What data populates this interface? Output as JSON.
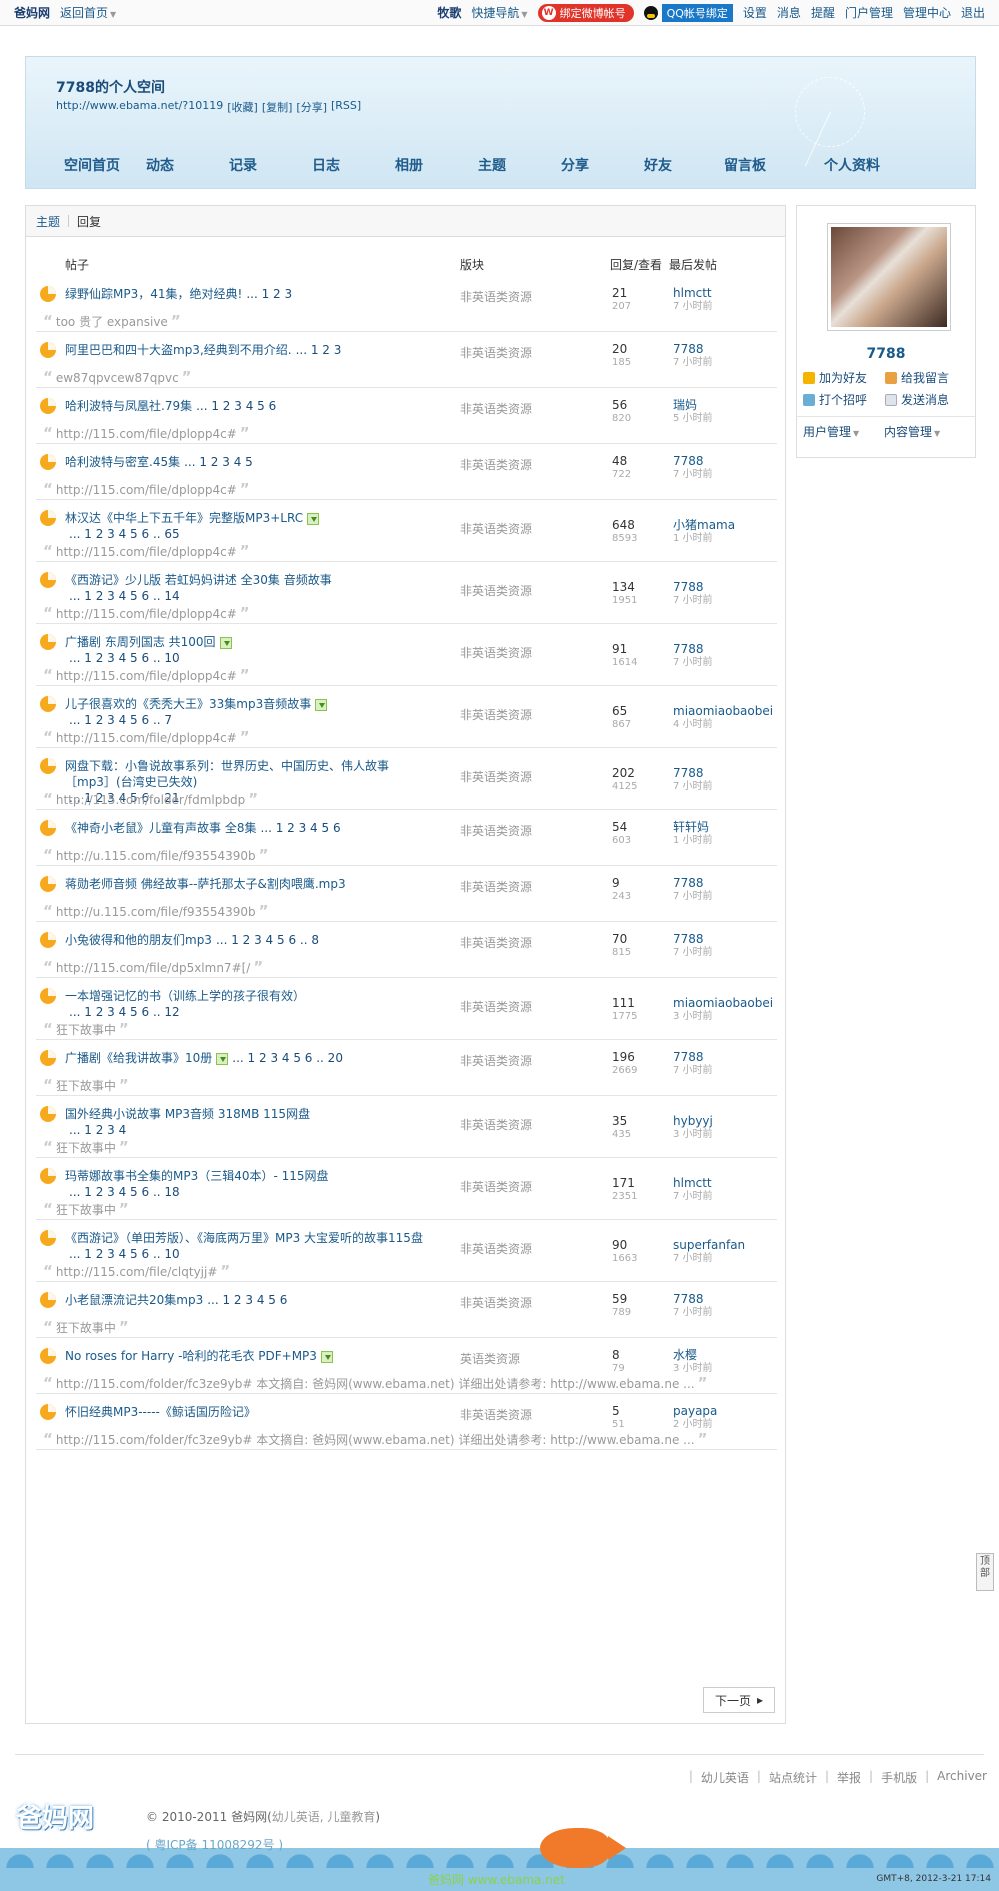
{
  "topbar": {
    "brand": "爸妈网",
    "back_home": "返回首页",
    "left_links": [],
    "right_links": [
      "牧歌",
      "快捷导航"
    ],
    "weibo": "绑定微博帐号",
    "qq": "QQ帐号绑定",
    "menu": [
      "设置",
      "消息",
      "提醒",
      "门户管理",
      "管理中心",
      "退出"
    ]
  },
  "header": {
    "title": "7788的个人空间",
    "url": "http://www.ebama.net/?10119",
    "url_actions": [
      "[收藏]",
      "[复制]",
      "[分享]",
      "[RSS]"
    ],
    "nav": [
      "空间首页",
      "动态",
      "记录",
      "日志",
      "相册",
      "主题",
      "分享",
      "好友",
      "留言板",
      "个人资料"
    ]
  },
  "tabs": {
    "theme": "主题",
    "reply": "回复"
  },
  "thead": {
    "subject": "帖子",
    "forum": "版块",
    "stats": "回复/查看",
    "last": "最后发帖"
  },
  "rows": [
    {
      "subject": "绿野仙踪MP3，41集，绝对经典!",
      "pages": "... 1 2 3",
      "dl": false,
      "forum": "非英语类资源",
      "replies": "21",
      "views": "207",
      "user": "hlmctt",
      "time": "7 小时前",
      "quote": "too 贵了 expansive"
    },
    {
      "subject": "阿里巴巴和四十大盗mp3,经典到不用介绍.",
      "pages": "... 1 2 3",
      "dl": false,
      "forum": "非英语类资源",
      "replies": "20",
      "views": "185",
      "user": "7788",
      "time": "7 小时前",
      "quote": "ew87qpvcew87qpvc"
    },
    {
      "subject": "哈利波特与凤凰社.79集",
      "pages": "... 1 2 3 4 5 6",
      "dl": false,
      "forum": "非英语类资源",
      "replies": "56",
      "views": "820",
      "user": "瑞妈",
      "time": "5 小时前",
      "quote": "http://115.com/file/dplopp4c#"
    },
    {
      "subject": "哈利波特与密室.45集",
      "pages": "... 1 2 3 4 5",
      "dl": false,
      "forum": "非英语类资源",
      "replies": "48",
      "views": "722",
      "user": "7788",
      "time": "7 小时前",
      "quote": "http://115.com/file/dplopp4c#"
    },
    {
      "subject": "林汉达《中华上下五千年》完整版MP3+LRC",
      "pages": "... 1 2 3 4 5 6 .. 65",
      "dl": true,
      "forum": "非英语类资源",
      "replies": "648",
      "views": "8593",
      "user": "小猪mama",
      "time": "1 小时前",
      "quote": "http://115.com/file/dplopp4c#"
    },
    {
      "subject": "《西游记》少儿版 若虹妈妈讲述 全30集 音频故事",
      "pages": "... 1 2 3 4 5 6 .. 14",
      "dl": false,
      "forum": "非英语类资源",
      "replies": "134",
      "views": "1951",
      "user": "7788",
      "time": "7 小时前",
      "quote": "http://115.com/file/dplopp4c#"
    },
    {
      "subject": "广播剧 东周列国志 共100回",
      "pages": "... 1 2 3 4 5 6 .. 10",
      "dl": true,
      "forum": "非英语类资源",
      "replies": "91",
      "views": "1614",
      "user": "7788",
      "time": "7 小时前",
      "quote": "http://115.com/file/dplopp4c#"
    },
    {
      "subject": "儿子很喜欢的《秃秃大王》33集mp3音频故事",
      "pages": "... 1 2 3 4 5 6 .. 7",
      "dl": true,
      "forum": "非英语类资源",
      "replies": "65",
      "views": "867",
      "user": "miaomiaobaobei",
      "time": "4 小时前",
      "quote": "http://115.com/file/dplopp4c#"
    },
    {
      "subject": "网盘下载：小鲁说故事系列：世界历史、中国历史、伟人故事［mp3］(台湾史已失效)",
      "pages": "... 1 2 3 4 5 6 .. 21",
      "dl": false,
      "forum": "非英语类资源",
      "replies": "202",
      "views": "4125",
      "user": "7788",
      "time": "7 小时前",
      "quote": "http://115.com/folder/fdmlpbdp"
    },
    {
      "subject": "《神奇小老鼠》儿童有声故事 全8集",
      "pages": "... 1 2 3 4 5 6",
      "dl": false,
      "forum": "非英语类资源",
      "replies": "54",
      "views": "603",
      "user": "轩轩妈",
      "time": "1 小时前",
      "quote": "http://u.115.com/file/f93554390b"
    },
    {
      "subject": "蒋勋老师音频 佛经故事--萨托那太子&割肉喂鹰.mp3",
      "pages": "",
      "dl": false,
      "forum": "非英语类资源",
      "replies": "9",
      "views": "243",
      "user": "7788",
      "time": "7 小时前",
      "quote": "http://u.115.com/file/f93554390b"
    },
    {
      "subject": "小兔彼得和他的朋友们mp3",
      "pages": "... 1 2 3 4 5 6 .. 8",
      "dl": false,
      "forum": "非英语类资源",
      "replies": "70",
      "views": "815",
      "user": "7788",
      "time": "7 小时前",
      "quote": "http://115.com/file/dp5xlmn7#[/"
    },
    {
      "subject": "一本增强记忆的书（训练上学的孩子很有效）",
      "pages": "... 1 2 3 4 5 6 .. 12",
      "dl": false,
      "forum": "非英语类资源",
      "replies": "111",
      "views": "1775",
      "user": "miaomiaobaobei",
      "time": "3 小时前",
      "quote": "狂下故事中"
    },
    {
      "subject": "广播剧《给我讲故事》10册",
      "pages": "... 1 2 3 4 5 6 .. 20",
      "dl": true,
      "forum": "非英语类资源",
      "replies": "196",
      "views": "2669",
      "user": "7788",
      "time": "7 小时前",
      "quote": "狂下故事中"
    },
    {
      "subject": "国外经典小说故事 MP3音频 318MB 115网盘",
      "pages": "... 1 2 3 4",
      "dl": false,
      "forum": "非英语类资源",
      "replies": "35",
      "views": "435",
      "user": "hybyyj",
      "time": "3 小时前",
      "quote": "狂下故事中"
    },
    {
      "subject": "玛蒂娜故事书全集的MP3（三辑40本）- 115网盘",
      "pages": "... 1 2 3 4 5 6 .. 18",
      "dl": false,
      "forum": "非英语类资源",
      "replies": "171",
      "views": "2351",
      "user": "hlmctt",
      "time": "7 小时前",
      "quote": "狂下故事中"
    },
    {
      "subject": "《西游记》（单田芳版）、《海底两万里》MP3 大宝爱听的故事115盘",
      "pages": "... 1 2 3 4 5 6 .. 10",
      "dl": false,
      "forum": "非英语类资源",
      "replies": "90",
      "views": "1663",
      "user": "superfanfan",
      "time": "7 小时前",
      "quote": "http://115.com/file/clqtyjj#"
    },
    {
      "subject": "小老鼠漂流记共20集mp3",
      "pages": "... 1 2 3 4 5 6",
      "dl": false,
      "forum": "非英语类资源",
      "replies": "59",
      "views": "789",
      "user": "7788",
      "time": "7 小时前",
      "quote": "狂下故事中"
    },
    {
      "subject": "No roses for Harry -哈利的花毛衣 PDF+MP3",
      "pages": "",
      "dl": true,
      "forum": "英语类资源",
      "replies": "8",
      "views": "79",
      "user": "水樱",
      "time": "3 小时前",
      "quote": "http://115.com/folder/fc3ze9yb# 本文摘自: 爸妈网(www.ebama.net) 详细出处请参考: http://www.ebama.ne ..."
    },
    {
      "subject": "怀旧经典MP3-----《鲸话国历险记》",
      "pages": "",
      "dl": false,
      "forum": "非英语类资源",
      "replies": "5",
      "views": "51",
      "user": "payapa",
      "time": "2 小时前",
      "quote": "http://115.com/folder/fc3ze9yb# 本文摘自: 爸妈网(www.ebama.net) 详细出处请参考: http://www.ebama.ne ..."
    }
  ],
  "next_page": "下一页",
  "side": {
    "username": "7788",
    "actions": [
      "加为好友",
      "给我留言",
      "打个招呼",
      "发送消息"
    ],
    "managers": [
      "用户管理",
      "内容管理"
    ]
  },
  "totop": "顶部",
  "footer": {
    "links": [
      "幼儿英语",
      "站点统计",
      "举报",
      "手机版",
      "Archiver"
    ],
    "copyright_prefix": "© 2010-2011",
    "copyright_site": "爸妈网(",
    "copyright_tags": "幼儿英语, 儿童教育",
    "copyright_suffix": ")",
    "icp": "( 粤ICP备 11008292号 )",
    "logo": "爸妈网",
    "site": "爸妈网 www.ebama.net",
    "gmt": "GMT+8, 2012-3-21 17:14"
  }
}
